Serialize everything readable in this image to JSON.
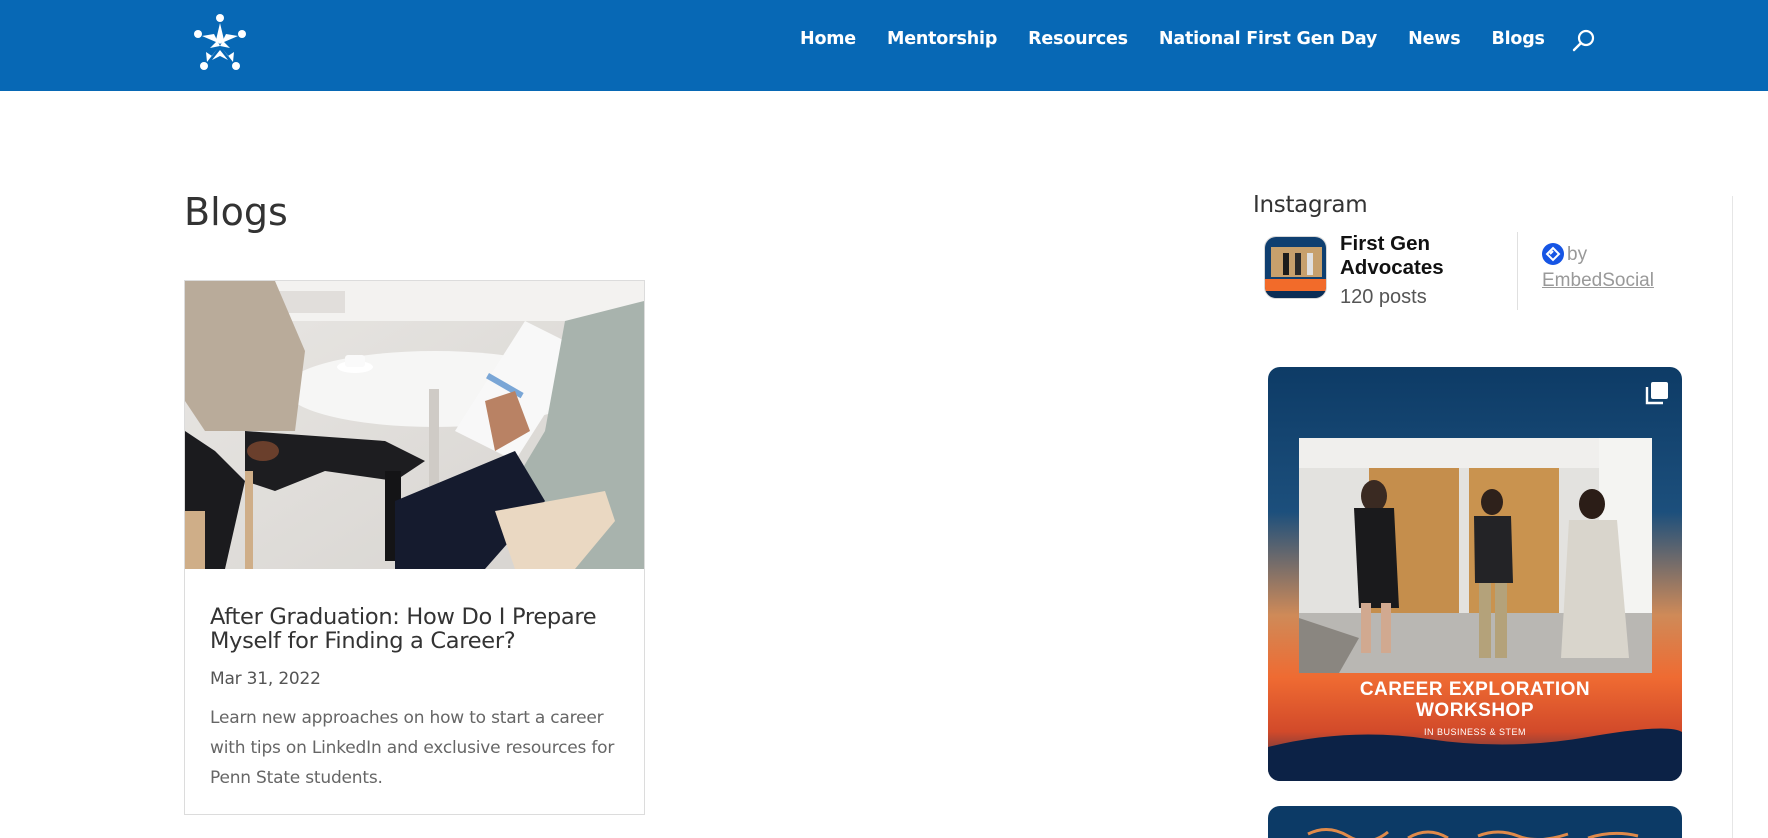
{
  "header": {
    "background_color": "#0768b5",
    "logo_icon": "people-star-logo-icon",
    "nav": [
      {
        "label": "Home"
      },
      {
        "label": "Mentorship"
      },
      {
        "label": "Resources"
      },
      {
        "label": "National First Gen Day"
      },
      {
        "label": "News"
      },
      {
        "label": "Blogs"
      }
    ],
    "search_icon": "search-icon"
  },
  "main": {
    "page_title": "Blogs",
    "posts": [
      {
        "title": "After Graduation: How Do I Prepare Myself for Finding a Career?",
        "date": "Mar 31, 2022",
        "excerpt": "Learn new approaches on how to start a career with tips on LinkedIn and exclusive resources for Penn State students."
      }
    ]
  },
  "sidebar": {
    "widget_title": "Instagram",
    "instagram": {
      "account_name": "First Gen Advocates",
      "posts_count": "120 posts",
      "by_label": "by",
      "provider": "EmbedSocial",
      "feed": [
        {
          "caption_line1": "CAREER EXPLORATION",
          "caption_line2": "WORKSHOP",
          "caption_line3": "IN BUSINESS & STEM",
          "multi_icon": "multiple-images-icon"
        }
      ]
    }
  },
  "colors": {
    "accent": "#0768b5",
    "embed_badge": "#1655e4"
  }
}
